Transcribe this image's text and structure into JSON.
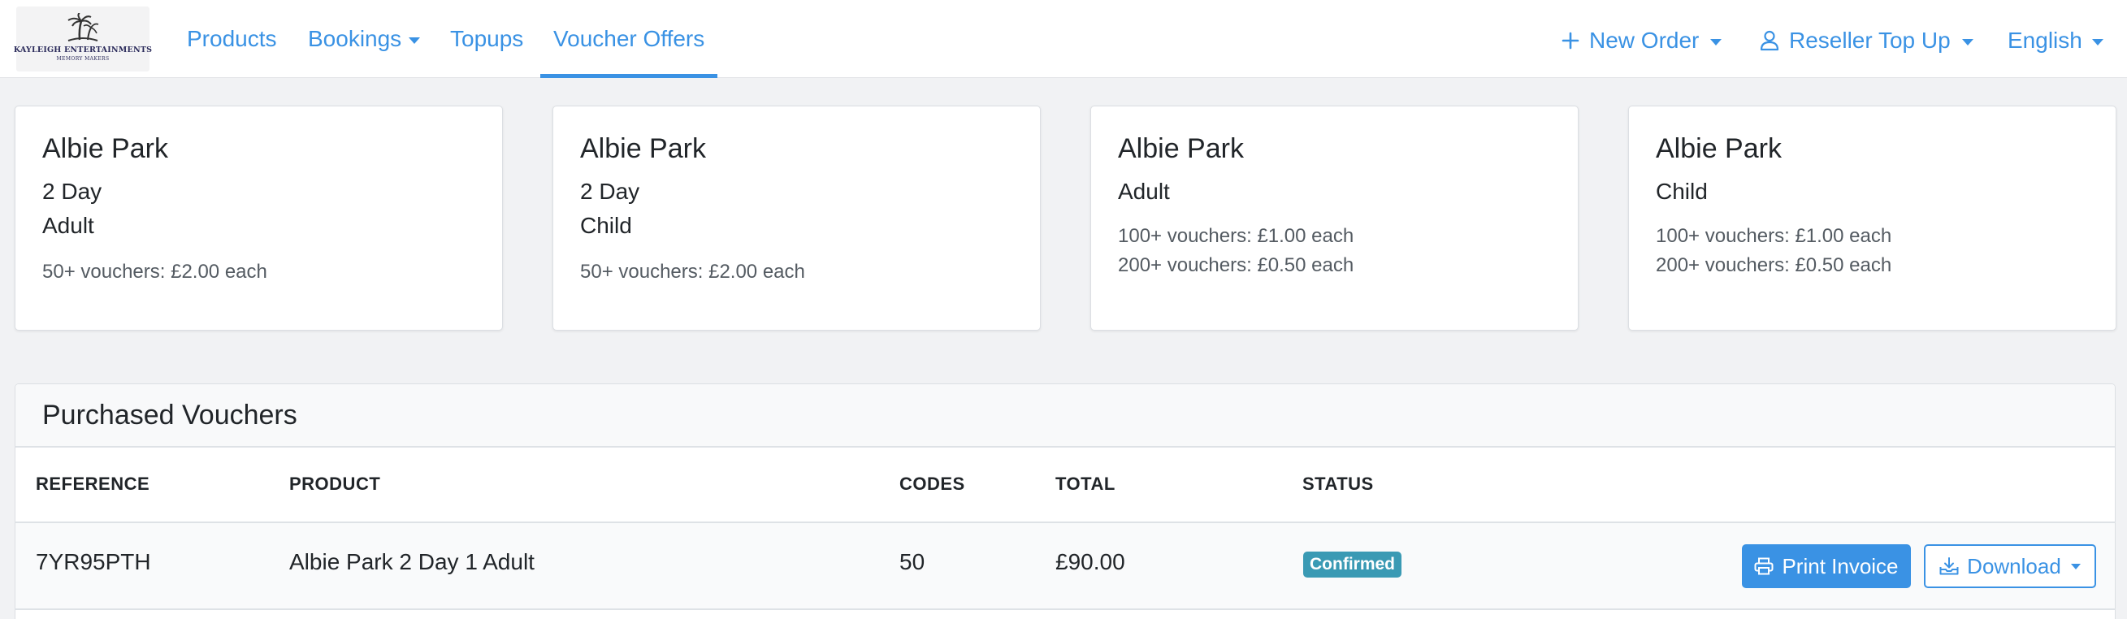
{
  "brand": {
    "name": "KAYLEIGH ENTERTAINMENTS",
    "tagline": "MEMORY MAKERS"
  },
  "nav": {
    "products": "Products",
    "bookings": "Bookings",
    "topups": "Topups",
    "voucher_offers": "Voucher Offers",
    "new_order": "New Order",
    "reseller_top_up": "Reseller Top Up",
    "language": "English"
  },
  "offers": [
    {
      "title": "Albie Park",
      "lines": [
        "2 Day",
        "Adult"
      ],
      "prices": [
        "50+ vouchers: £2.00 each"
      ]
    },
    {
      "title": "Albie Park",
      "lines": [
        "2 Day",
        "Child"
      ],
      "prices": [
        "50+ vouchers: £2.00 each"
      ]
    },
    {
      "title": "Albie Park",
      "lines": [
        "Adult"
      ],
      "prices": [
        "100+ vouchers: £1.00 each",
        "200+ vouchers: £0.50 each"
      ]
    },
    {
      "title": "Albie Park",
      "lines": [
        "Child"
      ],
      "prices": [
        "100+ vouchers: £1.00 each",
        "200+ vouchers: £0.50 each"
      ]
    }
  ],
  "purchased": {
    "title": "Purchased Vouchers",
    "columns": {
      "reference": "REFERENCE",
      "product": "PRODUCT",
      "codes": "CODES",
      "total": "TOTAL",
      "status": "STATUS"
    },
    "rows": [
      {
        "reference": "7YR95PTH",
        "product": "Albie Park 2 Day 1 Adult",
        "codes": "50",
        "total": "£90.00",
        "status": "Confirmed"
      }
    ],
    "actions": {
      "print": "Print Invoice",
      "download": "Download"
    }
  },
  "colors": {
    "accent": "#3a92e4",
    "status_confirmed": "#3a9ab4"
  }
}
